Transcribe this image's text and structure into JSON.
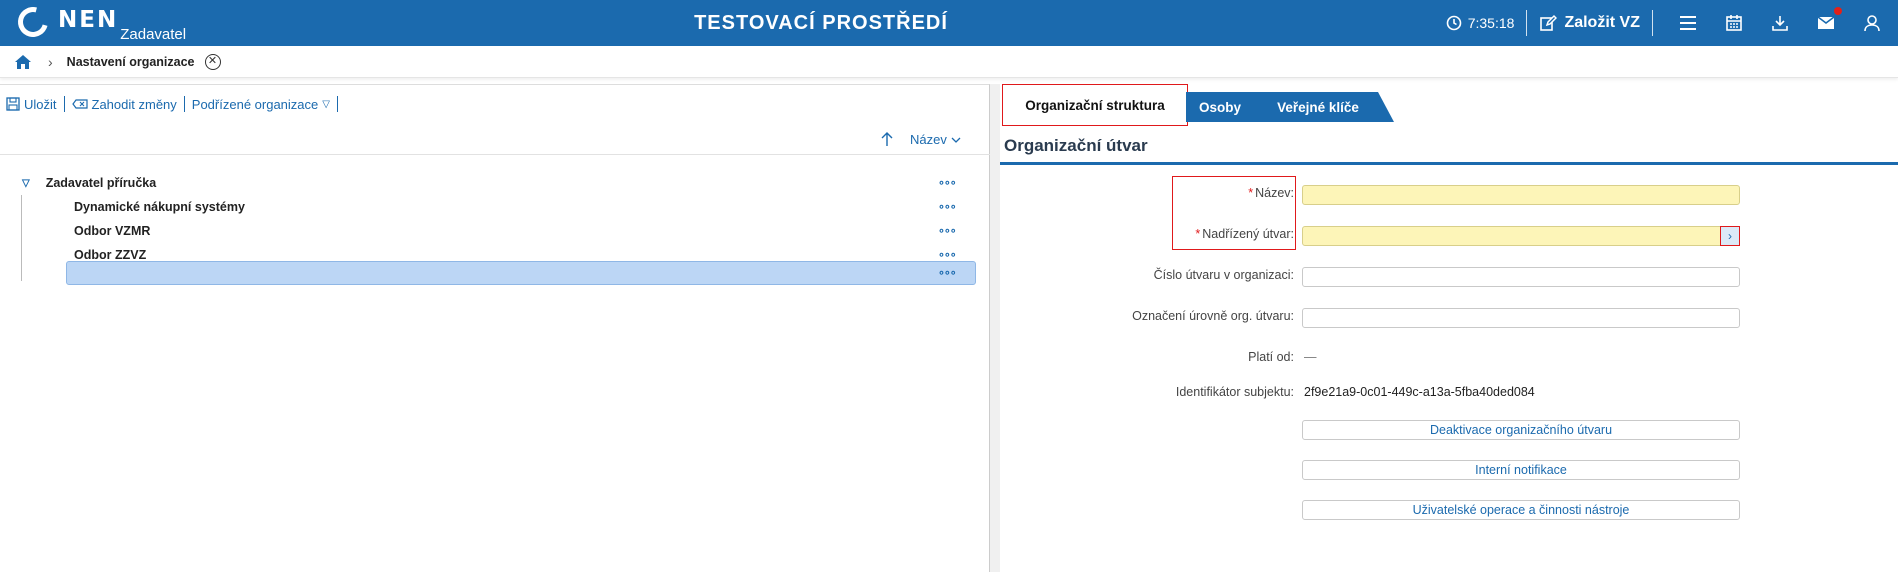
{
  "header": {
    "logo_text": "NEN",
    "logo_subtitle": "Zadavatel",
    "environment_title": "TESTOVACÍ PROSTŘEDÍ",
    "clock_time": "7:35:18",
    "create_label": "Založit VZ",
    "icons": [
      "clock-icon",
      "edit-icon",
      "menu-icon",
      "calendar-icon",
      "download-icon",
      "mail-icon",
      "user-icon"
    ],
    "mail_badge_color": "#e32119"
  },
  "breadcrumb": {
    "current": "Nastavení organizace"
  },
  "toolbar": {
    "save_label": "Uložit",
    "discard_label": "Zahodit změny",
    "subordinate_label": "Podřízené organizace"
  },
  "sort": {
    "label": "Název"
  },
  "tree": {
    "root": "Zadavatel příručka",
    "children": [
      "Dynamické nákupní systémy",
      "Odbor VZMR",
      "Odbor ZZVZ",
      ""
    ],
    "more_glyph": "∘∘∘"
  },
  "tabs": [
    "Organizační struktura",
    "Osoby",
    "Veřejné klíče"
  ],
  "section": {
    "title": "Organizační útvar"
  },
  "form": {
    "name_label": "Název:",
    "parent_label": "Nadřízený útvar:",
    "number_label": "Číslo útvaru v organizaci:",
    "level_label": "Označení úrovně org. útvaru:",
    "valid_from_label": "Platí od:",
    "valid_from_value": "—",
    "subject_id_label": "Identifikátor subjektu:",
    "subject_id_value": "2f9e21a9-0c01-449c-a13a-5fba40ded084",
    "name_value": "",
    "parent_value": "",
    "number_value": "",
    "level_value": ""
  },
  "actions": {
    "deactivate": "Deaktivace organizačního útvaru",
    "notifications": "Interní notifikace",
    "user_operations": "Uživatelské operace a činnosti nástroje"
  },
  "colors": {
    "brand": "#1b6aae",
    "required_field": "#fdf5b8",
    "highlight_border": "#e0191b",
    "selection": "#bcd6f5"
  }
}
